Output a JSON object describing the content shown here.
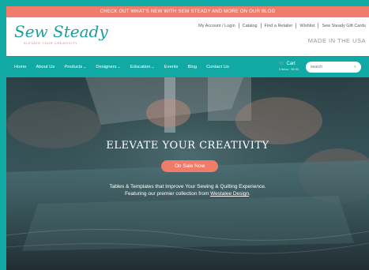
{
  "announcement": "Check out what's new with Sew Steady and more on our blog",
  "logo": {
    "name": "Sew Steady",
    "tagline": "Elevate your creativity"
  },
  "utility_links": [
    "My Account / Login",
    "Catalog",
    "Find a Retailer",
    "Wishlist",
    "Sew Steady Gift Cards"
  ],
  "made_in": "MADE IN THE USA",
  "nav": {
    "items": [
      {
        "label": "Home",
        "dropdown": false
      },
      {
        "label": "About Us",
        "dropdown": false
      },
      {
        "label": "Products",
        "dropdown": true
      },
      {
        "label": "Designers",
        "dropdown": true
      },
      {
        "label": "Education",
        "dropdown": true
      },
      {
        "label": "Events",
        "dropdown": false
      },
      {
        "label": "Blog",
        "dropdown": false
      },
      {
        "label": "Contact Us",
        "dropdown": false
      }
    ],
    "cart_label": "Cart",
    "cart_summary": "0 items · $0.00",
    "search_placeholder": "search"
  },
  "hero": {
    "title": "ELEVATE YOUR CREATIVITY",
    "button": "On Sale Now",
    "line1": "Tables & Templates that Improve Your Sewing & Quilting Experience.",
    "line2_prefix": "Featuring our premier collection from ",
    "line2_link": "Westalee Design",
    "line2_suffix": "."
  },
  "colors": {
    "teal": "#10a9a3",
    "coral": "#f07c6c"
  }
}
